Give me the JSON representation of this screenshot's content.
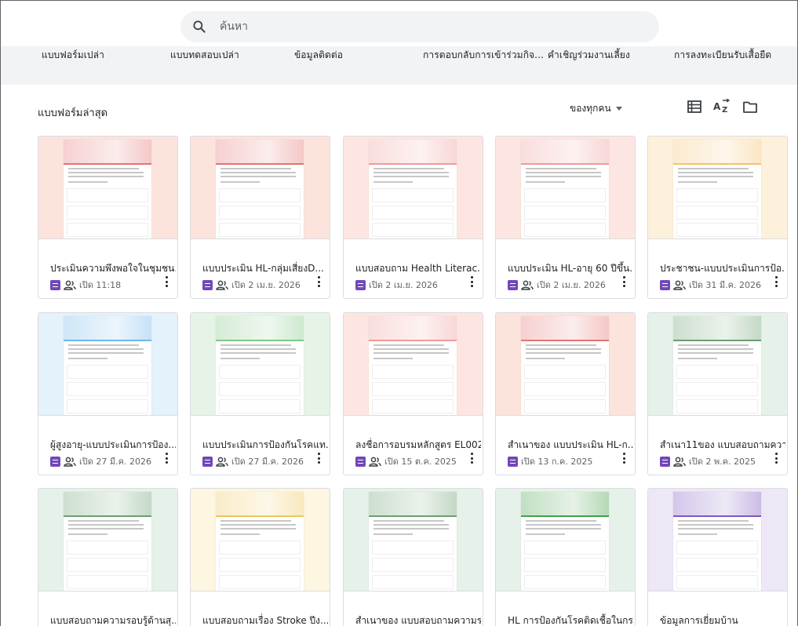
{
  "search": {
    "placeholder": "ค้นหา"
  },
  "templates": [
    "แบบฟอร์มเปล่า",
    "แบบทดสอบเปล่า",
    "ข้อมูลติดต่อ",
    "การตอบกลับการเข้าร่วมกิจ...",
    "คำเชิญร่วมงานเลี้ยง",
    "การลงทะเบียนรับเสื้อยืด"
  ],
  "section_title": "แบบฟอร์มล่าสุด",
  "owner_filter": "ของทุกคน",
  "icons": {
    "search": "search-icon",
    "list_view": "list-view-icon",
    "sort": "sort-az-icon",
    "folder": "folder-icon",
    "form": "forms-icon",
    "shared": "people-icon",
    "more": "more-vert-icon"
  },
  "cards": [
    {
      "title": "ประเมินความพึงพอใจในชุมชน...",
      "opened": "เปิด 11:18",
      "shared": true,
      "bg": "#fce4dc",
      "band": "#e57373"
    },
    {
      "title": "แบบประเมิน HL-กลุ่มเสี่ยงD...",
      "opened": "เปิด 2 เม.ย. 2026",
      "shared": true,
      "bg": "#fce4dc",
      "band": "#e57373"
    },
    {
      "title": "แบบสอบถาม Health Literac...",
      "opened": "เปิด 2 เม.ย. 2026",
      "shared": false,
      "bg": "#fde6e1",
      "band": "#ef9a9a"
    },
    {
      "title": "แบบประเมิน HL-อายุ 60 ปีขึ้น...",
      "opened": "เปิด 2 เม.ย. 2026",
      "shared": true,
      "bg": "#fde6e1",
      "band": "#ef9a9a"
    },
    {
      "title": "ประชาชน-แบบประเมินการป้อ...",
      "opened": "เปิด 31 มี.ค. 2026",
      "shared": true,
      "bg": "#fdf1dc",
      "band": "#f4c16b"
    },
    {
      "title": "ผู้สูงอายุ-แบบประเมินการป้อง...",
      "opened": "เปิด 27 มี.ค. 2026",
      "shared": true,
      "bg": "#e4f2fb",
      "band": "#6fb6e8"
    },
    {
      "title": "แบบประเมินการป้องกันโรคแท...",
      "opened": "เปิด 27 มี.ค. 2026",
      "shared": true,
      "bg": "#e6f4e8",
      "band": "#81c784"
    },
    {
      "title": "ลงชื่อการอบรมหลักสูตร EL002",
      "opened": "เปิด 15 ต.ค. 2025",
      "shared": true,
      "bg": "#fde6e1",
      "band": "#ef9a9a"
    },
    {
      "title": "สำเนาของ แบบประเมิน HL-ก...",
      "opened": "เปิด 13 ก.ค. 2025",
      "shared": false,
      "bg": "#fce4dc",
      "band": "#e57373"
    },
    {
      "title": "สำเนา11ของ แบบสอบถามควา...",
      "opened": "เปิด 2 พ.ค. 2025",
      "shared": true,
      "bg": "#e6f1ea",
      "band": "#6a9e72"
    },
    {
      "title": "แบบสอบถามความรอบรู้ด้านสุ...",
      "opened": "",
      "shared": false,
      "bg": "#e6f1ea",
      "band": "#6a9e72"
    },
    {
      "title": "แบบสอบถามเรื่อง Stroke ปีง...",
      "opened": "",
      "shared": false,
      "bg": "#fdf6e0",
      "band": "#f0c65a"
    },
    {
      "title": "สำเนาของ แบบสอบถามความร...",
      "opened": "",
      "shared": false,
      "bg": "#e6f1ea",
      "band": "#6a9e72"
    },
    {
      "title": "HL การป้องกันโรคติดเชื้อในกร...",
      "opened": "",
      "shared": false,
      "bg": "#e6f1ea",
      "band": "#43a047"
    },
    {
      "title": "ข้อมูลการเยี่ยมบ้าน",
      "opened": "",
      "shared": false,
      "bg": "#ede7f6",
      "band": "#7e57c2"
    }
  ]
}
